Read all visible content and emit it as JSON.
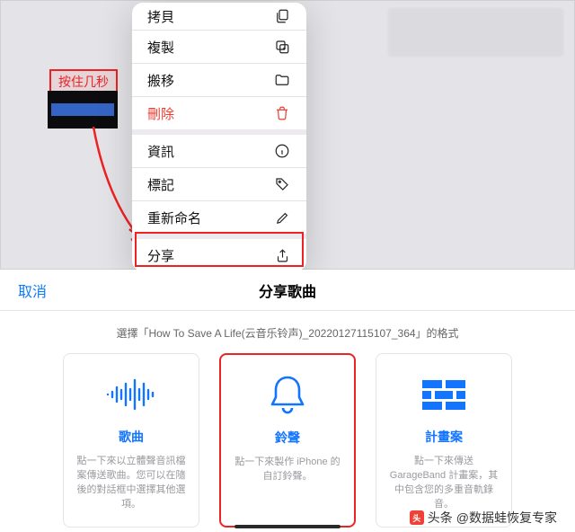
{
  "callout": "按住几秒",
  "menu": {
    "copy": "拷貝",
    "duplicate": "複製",
    "move": "搬移",
    "delete": "刪除",
    "info": "資訊",
    "tag": "標記",
    "rename": "重新命名",
    "share": "分享"
  },
  "share_panel": {
    "cancel": "取消",
    "title": "分享歌曲",
    "subtitle": "選擇「How To Save A Life(云音乐铃声)_20220127115107_364」的格式"
  },
  "cards": {
    "song": {
      "title": "歌曲",
      "desc": "點一下來以立體聲音訊檔案傳送歌曲。您可以在隨後的對話框中選擇其他選項。"
    },
    "ringtone": {
      "title": "鈴聲",
      "desc": "點一下來製作 iPhone 的自訂鈴聲。"
    },
    "project": {
      "title": "計畫案",
      "desc": "點一下來傳送 GarageBand 計畫案，其中包含您的多重音軌錄音。"
    }
  },
  "attribution": {
    "prefix": "头条",
    "at": "@数据蛙恢复专家"
  }
}
